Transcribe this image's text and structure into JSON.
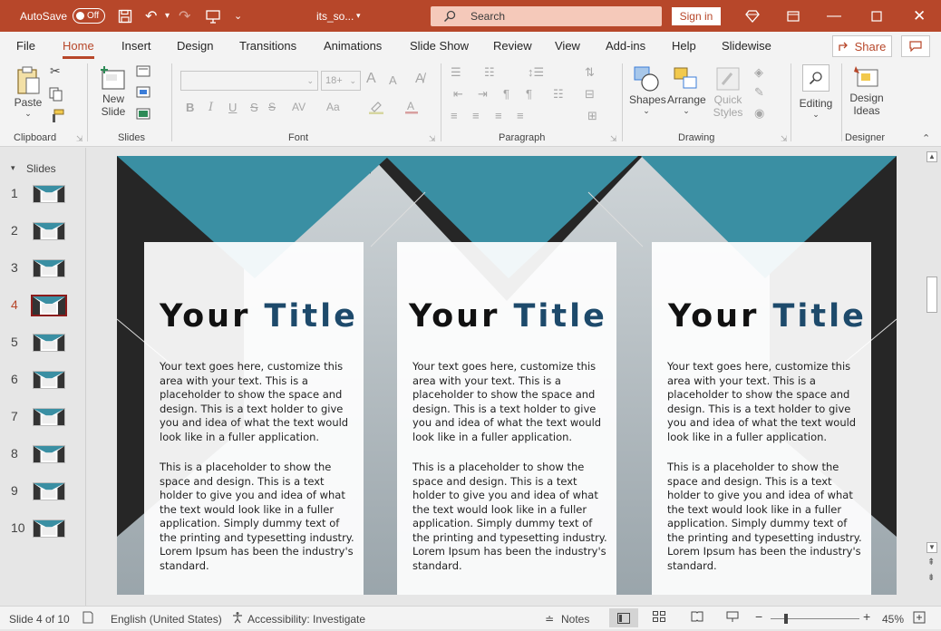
{
  "titlebar": {
    "autosave_label": "AutoSave",
    "autosave_state": "Off",
    "filename": "its_so...",
    "search_placeholder": "Search",
    "signin_label": "Sign in"
  },
  "menu": {
    "tabs": [
      "File",
      "Home",
      "Insert",
      "Design",
      "Transitions",
      "Animations",
      "Slide Show",
      "Review",
      "View",
      "Add-ins",
      "Help",
      "Slidewise"
    ],
    "active": "Home",
    "share_label": "Share"
  },
  "ribbon": {
    "clipboard": {
      "label": "Clipboard",
      "paste": "Paste"
    },
    "slides": {
      "label": "Slides",
      "new_slide_1": "New",
      "new_slide_2": "Slide"
    },
    "font": {
      "label": "Font",
      "size": "18+",
      "bold": "B",
      "italic": "I",
      "underline": "U",
      "strike": "S",
      "spacing": "AV",
      "case": "Aa",
      "grow": "A",
      "shrink": "A"
    },
    "paragraph": {
      "label": "Paragraph"
    },
    "drawing": {
      "label": "Drawing",
      "shapes": "Shapes",
      "arrange": "Arrange",
      "quick_styles_1": "Quick",
      "quick_styles_2": "Styles"
    },
    "editing": {
      "label": "Editing"
    },
    "designer": {
      "label": "Designer",
      "design_ideas_1": "Design",
      "design_ideas_2": "Ideas"
    }
  },
  "thumbnails": {
    "header": "Slides",
    "numbers": [
      "1",
      "2",
      "3",
      "4",
      "5",
      "6",
      "7",
      "8",
      "9",
      "10"
    ],
    "active_index": 3
  },
  "slide": {
    "panels": [
      {
        "title_a": "Your",
        "title_b": "Title",
        "para1": "Your text goes here, customize this area with your text. This is a placeholder to show the space and design. This is a text holder to give you and idea of what the text would look like in a fuller application.",
        "para2": "This is a placeholder to show the space and design. This is a text holder to give you and idea of what the text would look like in a fuller application. Simply dummy text of the printing and typesetting industry. Lorem Ipsum has been the industry's standard."
      },
      {
        "title_a": "Your",
        "title_b": "Title",
        "para1": "Your text goes here, customize this area with your text. This is a placeholder to show the space and design. This is a text holder to give you and idea of what the text would look like in a fuller application.",
        "para2": "This is a placeholder to show the space and design. This is a text holder to give you and idea of what the text would look like in a fuller application. Simply dummy text of the printing and typesetting industry. Lorem Ipsum has been the industry's standard."
      },
      {
        "title_a": "Your",
        "title_b": "Title",
        "para1": "Your text goes here, customize this area with your text. This is a placeholder to show the space and design. This is a text holder to give you and idea of what the text would look like in a fuller application.",
        "para2": "This is a placeholder to show the space and design. This is a text holder to give you and idea of what the text would look like in a fuller application. Simply dummy text of the printing and typesetting industry. Lorem Ipsum has been the industry's standard."
      }
    ],
    "colors": {
      "teal": "#3a8fa3",
      "dark": "#262626",
      "title_blue": "#1d4a6b"
    }
  },
  "status": {
    "slide_counter": "Slide 4 of 10",
    "language": "English (United States)",
    "accessibility": "Accessibility: Investigate",
    "notes": "Notes",
    "zoom": "45%"
  },
  "colors": {
    "accent": "#b7472a"
  }
}
